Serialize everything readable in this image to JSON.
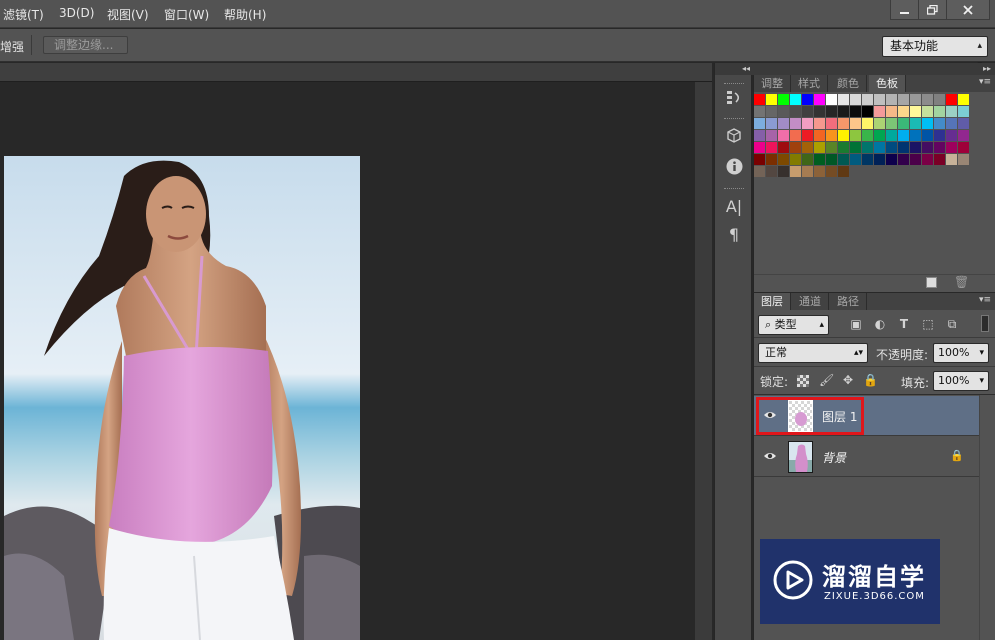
{
  "menu": [
    "滤镜(T)",
    "3D(D)",
    "视图(V)",
    "窗口(W)",
    "帮助(H)"
  ],
  "window_buttons": [
    "minimize-icon",
    "restore-icon",
    "close-icon"
  ],
  "options_bar": {
    "partial_label": "增强",
    "refine_edge_button": "调整边缘...",
    "workspace": "基本功能"
  },
  "swatches_panel": {
    "tabs": [
      "调整",
      "样式",
      "颜色",
      "色板"
    ],
    "active_tab": "色板",
    "colors": [
      "#ff0000",
      "#ffff00",
      "#00ff00",
      "#00ffff",
      "#0000ff",
      "#ff00ff",
      "#ffffff",
      "#e6e6e6",
      "#d9d9d9",
      "#cccccc",
      "#bfbfbf",
      "#b3b3b3",
      "#a6a6a6",
      "#999999",
      "#8c8c8c",
      "#808080",
      "#ff0000",
      "#ffff00",
      "#737373",
      "#666666",
      "#595959",
      "#4d4d4d",
      "#404040",
      "#333333",
      "#262626",
      "#1a1a1a",
      "#0d0d0d",
      "#000000",
      "#f49a9a",
      "#f6b888",
      "#fbd78b",
      "#fff89a",
      "#c5e09c",
      "#a2d4a0",
      "#9cd0c4",
      "#7ccdd4",
      "#7cadde",
      "#8a9bd2",
      "#a18cc7",
      "#c38dc6",
      "#f19ec2",
      "#f5988e",
      "#f26d7d",
      "#f7976a",
      "#fdc68a",
      "#fff568",
      "#acd373",
      "#7cc576",
      "#3bb878",
      "#1abbb4",
      "#00bff3",
      "#438cca",
      "#5574b9",
      "#605ca8",
      "#855fa8",
      "#a763a8",
      "#f06ea9",
      "#f26c4f",
      "#ed1c24",
      "#f26522",
      "#f7941d",
      "#fff200",
      "#8dc63f",
      "#39b54a",
      "#00a651",
      "#00a99d",
      "#00aeef",
      "#0072bc",
      "#0054a6",
      "#2e3192",
      "#662d91",
      "#92278f",
      "#ec008c",
      "#ed145b",
      "#9e0b0f",
      "#a0410d",
      "#a36209",
      "#aba000",
      "#598527",
      "#1a7b30",
      "#007236",
      "#00746b",
      "#0076a3",
      "#004b80",
      "#003471",
      "#1b1464",
      "#440e62",
      "#630460",
      "#9e005d",
      "#9e0039",
      "#790000",
      "#7b2e00",
      "#7d4900",
      "#827b00",
      "#406618",
      "#005e20",
      "#005826",
      "#005952",
      "#005b7f",
      "#003663",
      "#002157",
      "#0d004c",
      "#32004b",
      "#4b0049",
      "#7b0046",
      "#7a0026",
      "#c7b299",
      "#998675",
      "#736357",
      "#534741",
      "#37302d",
      "#c69c6d",
      "#a67c52",
      "#8c6239",
      "#754c24",
      "#603913"
    ],
    "new_swatch_icon": "new-swatch-icon",
    "delete_swatch_icon": "trash-icon"
  },
  "layers_panel": {
    "tabs": [
      "图层",
      "通道",
      "路径"
    ],
    "active_tab": "图层",
    "filter_kind": "类型",
    "blend_mode": "正常",
    "opacity_label": "不透明度:",
    "opacity_value": "100%",
    "lock_label": "锁定:",
    "fill_label": "填充:",
    "fill_value": "100%",
    "layers": [
      {
        "name": "图层 1",
        "selected": true,
        "locked": false
      },
      {
        "name": "背景",
        "selected": false,
        "locked": true
      }
    ]
  },
  "watermark": {
    "title": "溜溜自学",
    "url": "ZIXUE.3D66.COM"
  },
  "highlight_color": "#e0161b",
  "selection_color": "#5f6f86"
}
